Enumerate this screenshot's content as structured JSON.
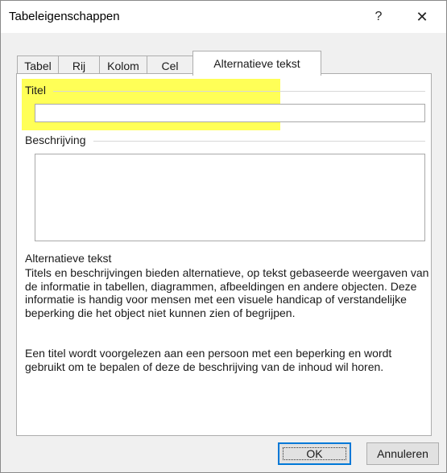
{
  "window": {
    "title": "Tabeleigenschappen",
    "help_glyph": "?",
    "close_glyph": "✕"
  },
  "tabs": [
    {
      "label": "Tabel",
      "active": false
    },
    {
      "label": "Rij",
      "active": false
    },
    {
      "label": "Kolom",
      "active": false
    },
    {
      "label": "Cel",
      "active": false
    },
    {
      "label": "Alternatieve tekst",
      "active": true
    }
  ],
  "fields": {
    "title_label": "Titel",
    "title_value": "",
    "description_label": "Beschrijving",
    "description_value": ""
  },
  "info": {
    "heading": "Alternatieve tekst",
    "paragraph1": "Titels en beschrijvingen bieden alternatieve, op tekst gebaseerde weergaven van de informatie in tabellen, diagrammen, afbeeldingen en andere objecten. Deze informatie is handig voor mensen met een visuele handicap of verstandelijke beperking die het object niet kunnen zien of begrijpen.",
    "paragraph2": "Een titel wordt voorgelezen aan een persoon met een beperking en wordt gebruikt om te bepalen of deze de beschrijving van de inhoud wil horen."
  },
  "buttons": {
    "ok": "OK",
    "cancel": "Annuleren"
  },
  "colors": {
    "highlight": "#ffff57",
    "default_button_border": "#0078d7"
  }
}
